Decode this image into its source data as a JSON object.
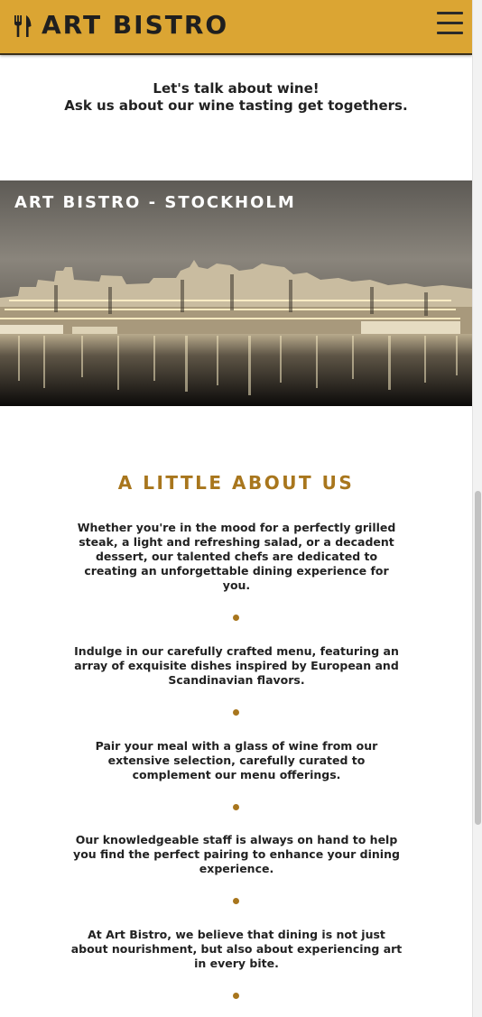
{
  "header": {
    "brand": "ART BISTRO",
    "logo_icon": "fork-knife-icon",
    "menu_icon": "hamburger-menu-icon",
    "background_color": "#dba533"
  },
  "wine": {
    "line1": "Let's talk about wine!",
    "line2": "Ask us about our wine tasting get togethers."
  },
  "hero": {
    "title": "ART BISTRO - STOCKHOLM"
  },
  "about": {
    "title": "A LITTLE ABOUT US",
    "accent_color": "#a8761d",
    "paragraphs": [
      "Whether you're in the mood for a perfectly grilled steak, a light and refreshing salad, or a decadent dessert, our talented chefs are dedicated to creating an unforgettable dining experience for you.",
      "Indulge in our carefully crafted menu, featuring an array of exquisite dishes inspired by European and Scandinavian flavors.",
      "Pair your meal with a glass of wine from our extensive selection, carefully curated to complement our menu offerings.",
      "Our knowledgeable staff is always on hand to help you find the perfect pairing to enhance your dining experience.",
      "At Art Bistro, we believe that dining is not just about nourishment, but also about experiencing art in every bite."
    ]
  }
}
